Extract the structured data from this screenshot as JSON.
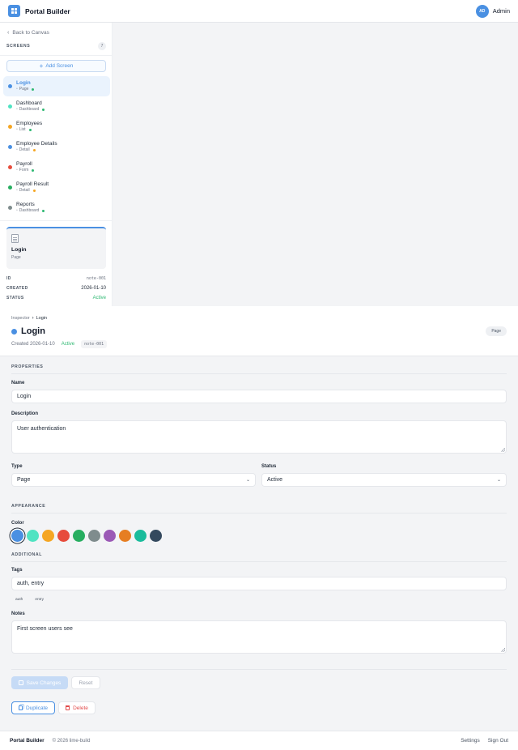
{
  "header": {
    "brand": "Portal Builder",
    "user_initials": "AD",
    "user_name": "Admin"
  },
  "sidebar": {
    "back_label": "Back to Canvas",
    "screens_title": "SCREENS",
    "screens_count": "7",
    "add_label": "Add Screen",
    "items": [
      {
        "name": "Login",
        "type": "Page",
        "dot": "#4a90e2",
        "status_dot": "#2eb872"
      },
      {
        "name": "Dashboard",
        "type": "Dashboard",
        "dot": "#50e3c2",
        "status_dot": "#2eb872"
      },
      {
        "name": "Employees",
        "type": "List",
        "dot": "#f5a623",
        "status_dot": "#2eb872"
      },
      {
        "name": "Employee Details",
        "type": "Detail",
        "dot": "#4a90e2",
        "status_dot": "#f5a623"
      },
      {
        "name": "Payroll",
        "type": "Form",
        "dot": "#e74c3c",
        "status_dot": "#2eb872"
      },
      {
        "name": "Payroll Result",
        "type": "Detail",
        "dot": "#27ae60",
        "status_dot": "#f5a623"
      },
      {
        "name": "Reports",
        "type": "Dashboard",
        "dot": "#7f8c8d",
        "status_dot": "#2eb872"
      }
    ],
    "preview": {
      "name": "Login",
      "type": "Page"
    },
    "meta": {
      "id_label": "ID",
      "id_value": "note-001",
      "created_label": "CREATED",
      "created_value": "2026-01-10",
      "status_label": "STATUS",
      "status_value": "Active"
    }
  },
  "inspector": {
    "crumb_root": "Inspector",
    "crumb_current": "Login",
    "title": "Login",
    "type_pill": "Page",
    "created_text": "Created 2026-01-10",
    "status_text": "Active",
    "id_text": "note-001"
  },
  "properties": {
    "section": "PROPERTIES",
    "name_label": "Name",
    "name_value": "Login",
    "description_label": "Description",
    "description_value": "User authentication",
    "type_label": "Type",
    "type_value": "Page",
    "status_label": "Status",
    "status_value": "Active"
  },
  "appearance": {
    "section": "APPEARANCE",
    "color_label": "Color",
    "colors": [
      "#4a90e2",
      "#50e3c2",
      "#f5a623",
      "#e74c3c",
      "#27ae60",
      "#7f8c8d",
      "#9b59b6",
      "#e67e22",
      "#1abc9c",
      "#34495e"
    ],
    "selected_color": "#4a90e2"
  },
  "additional": {
    "section": "ADDITIONAL",
    "tags_label": "Tags",
    "tags_value": "auth, entry",
    "tags": [
      "auth",
      "entry"
    ],
    "notes_label": "Notes",
    "notes_value": "First screen users see"
  },
  "actions": {
    "save_label": "Save Changes",
    "reset_label": "Reset",
    "duplicate_label": "Duplicate",
    "delete_label": "Delete"
  },
  "footer": {
    "brand": "Portal Builder",
    "copyright": "© 2026 lime-build",
    "settings_label": "Settings",
    "signout_label": "Sign Out"
  }
}
